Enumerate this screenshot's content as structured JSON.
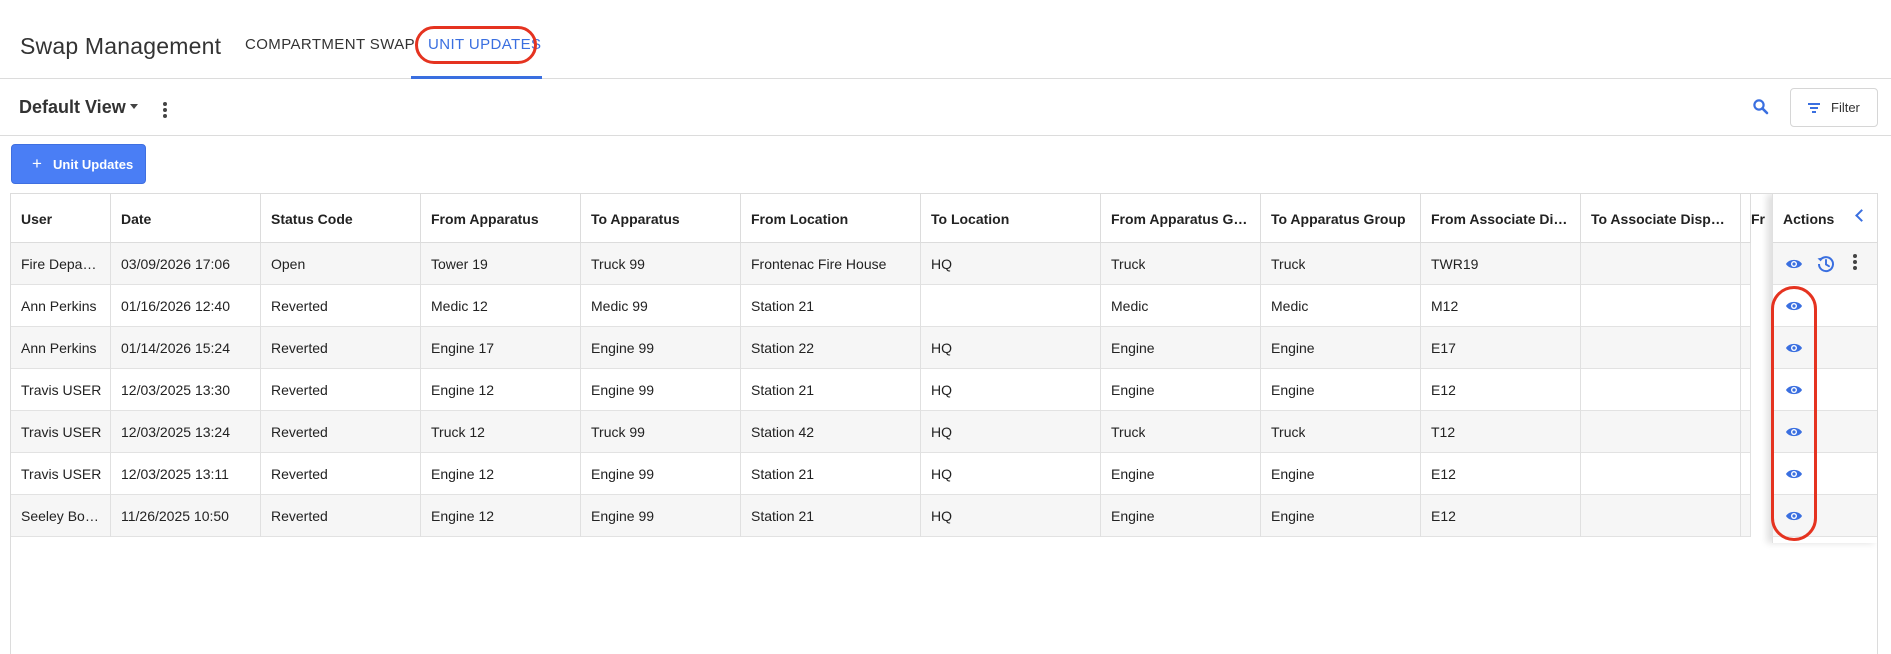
{
  "header": {
    "app_title": "Swap Management",
    "tabs": [
      {
        "label": "COMPARTMENT SWAP",
        "active": false
      },
      {
        "label": "UNIT UPDATES",
        "active": true
      }
    ]
  },
  "toolbar": {
    "view_name": "Default View",
    "filter_label": "Filter",
    "search_icon": "search-icon",
    "filter_icon": "filter-lines-icon"
  },
  "add_button": {
    "plus": "+",
    "label": "Unit Updates"
  },
  "colors": {
    "accent": "#3a6fe0",
    "button": "#4a7ef5",
    "highlight": "#e53320"
  },
  "table": {
    "columns": [
      "User",
      "Date",
      "Status Code",
      "From Apparatus",
      "To Apparatus",
      "From Location",
      "To Location",
      "From Apparatus G…",
      "To Apparatus Group",
      "From Associate Di…",
      "To Associate Disp…",
      "Fr"
    ],
    "actions_header": "Actions",
    "rows": [
      [
        "Fire Depa…",
        "03/09/2026 17:06",
        "Open",
        "Tower 19",
        "Truck 99",
        "Frontenac Fire House",
        "HQ",
        "Truck",
        "Truck",
        "TWR19",
        "",
        ""
      ],
      [
        "Ann Perkins",
        "01/16/2026 12:40",
        "Reverted",
        "Medic 12",
        "Medic 99",
        "Station 21",
        "",
        "Medic",
        "Medic",
        "M12",
        "",
        ""
      ],
      [
        "Ann Perkins",
        "01/14/2026 15:24",
        "Reverted",
        "Engine 17",
        "Engine 99",
        "Station 22",
        "HQ",
        "Engine",
        "Engine",
        "E17",
        "",
        ""
      ],
      [
        "Travis USER",
        "12/03/2025 13:30",
        "Reverted",
        "Engine 12",
        "Engine 99",
        "Station 21",
        "HQ",
        "Engine",
        "Engine",
        "E12",
        "",
        ""
      ],
      [
        "Travis USER",
        "12/03/2025 13:24",
        "Reverted",
        "Truck 12",
        "Truck 99",
        "Station 42",
        "HQ",
        "Truck",
        "Truck",
        "T12",
        "",
        ""
      ],
      [
        "Travis USER",
        "12/03/2025 13:11",
        "Reverted",
        "Engine 12",
        "Engine 99",
        "Station 21",
        "HQ",
        "Engine",
        "Engine",
        "E12",
        "",
        ""
      ],
      [
        "Seeley Bo…",
        "11/26/2025 10:50",
        "Reverted",
        "Engine 12",
        "Engine 99",
        "Station 21",
        "HQ",
        "Engine",
        "Engine",
        "E12",
        "",
        ""
      ]
    ],
    "row_actions": [
      [
        "view-eye-icon",
        "history-clock-icon",
        "more-vertical-icon"
      ],
      [
        "view-eye-icon"
      ],
      [
        "view-eye-icon"
      ],
      [
        "view-eye-icon"
      ],
      [
        "view-eye-icon"
      ],
      [
        "view-eye-icon"
      ],
      [
        "view-eye-icon"
      ]
    ]
  }
}
